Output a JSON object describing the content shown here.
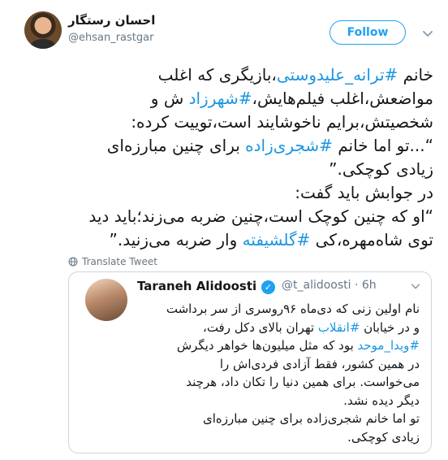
{
  "author": {
    "name": "احسان رستگار",
    "handle": "@ehsan_rastgar",
    "follow_label": "Follow"
  },
  "tweet": {
    "lines": [
      [
        {
          "t": "خانم ",
          "link": false
        },
        {
          "t": "#ترانه_علیدوستی",
          "link": true
        },
        {
          "t": "،بازیگری که اغلب",
          "link": false
        }
      ],
      [
        {
          "t": "مواضعش،اغلب فیلم‌هایش،",
          "link": false
        },
        {
          "t": "#شهرزاد",
          "link": true
        },
        {
          "t": " ش و",
          "link": false
        }
      ],
      [
        {
          "t": "شخصیتش،برایم ناخوشایند است،توییت کرده:",
          "link": false
        }
      ],
      [
        {
          "t": "“...تو اما خانم ",
          "link": false
        },
        {
          "t": "#شجری‌زاده",
          "link": true
        },
        {
          "t": " برای چنین مبارزه‌ای",
          "link": false
        }
      ],
      [
        {
          "t": "زیادی کوچکی.”",
          "link": false
        }
      ],
      [
        {
          "t": "در جوابش باید گفت:",
          "link": false
        }
      ],
      [
        {
          "t": "“او که چنین کوچک است،چنین ضربه می‌زند؛باید دید",
          "link": false
        }
      ],
      [
        {
          "t": "توی شاه‌مهره،کی ",
          "link": false
        },
        {
          "t": "#گلشیفته",
          "link": true
        },
        {
          "t": " وار ضربه می‌زنید.”",
          "link": false
        }
      ]
    ],
    "translate_label": "Translate Tweet"
  },
  "quote": {
    "name": "Taraneh Alidoosti",
    "handle": "@t_alidoosti · 6h",
    "lines": [
      [
        {
          "t": "نام اولین زنی که دی‌ماه ۹۶روسری از سر برداشت",
          "link": false
        }
      ],
      [
        {
          "t": "و در خیابان ",
          "link": false
        },
        {
          "t": "#انقلاب",
          "link": true
        },
        {
          "t": " تهران بالای دکل رفت،",
          "link": false
        }
      ],
      [
        {
          "t": "#ویدا_موحد",
          "link": true
        },
        {
          "t": " بود که مثل میلیون‌ها خواهر دیگرش",
          "link": false
        }
      ],
      [
        {
          "t": "در همین کشور، فقط آزادی فردی‌اش را",
          "link": false
        }
      ],
      [
        {
          "t": "می‌خواست. برای همین دنیا را تکان داد، هرچند",
          "link": false
        }
      ],
      [
        {
          "t": "دیگر دیده نشد.",
          "link": false
        }
      ],
      [
        {
          "t": "تو اما خانم شجری‌زاده برای چنین مبارزه‌ای",
          "link": false
        }
      ],
      [
        {
          "t": "زیادی کوچکی.",
          "link": false
        }
      ]
    ]
  },
  "colors": {
    "accent": "#1da1f2",
    "link": "#1b95e0",
    "muted": "#657786",
    "border": "#ccd6dd"
  },
  "icons": [
    "chevron-down-icon",
    "globe-icon",
    "verified-badge-icon"
  ]
}
